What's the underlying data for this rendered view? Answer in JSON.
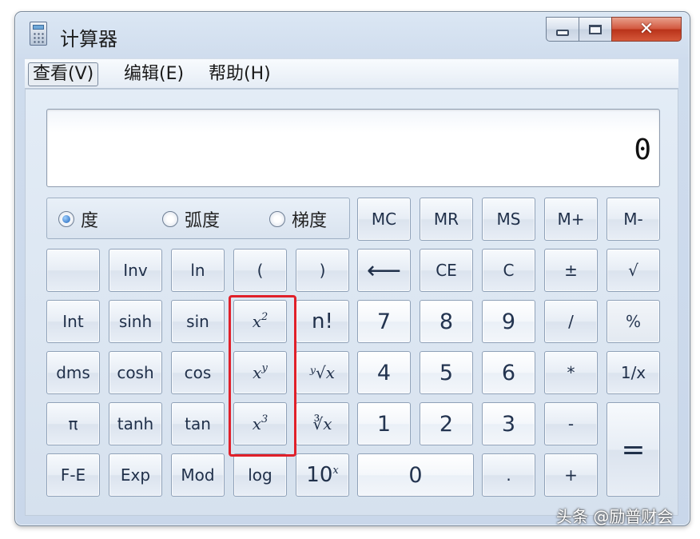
{
  "window": {
    "title": "计算器"
  },
  "menu": {
    "view": "查看(V)",
    "edit": "编辑(E)",
    "help": "帮助(H)"
  },
  "display": {
    "value": "0"
  },
  "angle_modes": {
    "degrees": "度",
    "radians": "弧度",
    "grads": "梯度",
    "selected": "度"
  },
  "memory": {
    "mc": "MC",
    "mr": "MR",
    "ms": "MS",
    "mplus": "M+",
    "mminus": "M-"
  },
  "row2": {
    "inv": "Inv",
    "ln": "ln",
    "lparen": "(",
    "rparen": ")",
    "backspace": "⟵",
    "ce": "CE",
    "c": "C",
    "plusminus": "±",
    "sqrt": "√"
  },
  "row3": {
    "int": "Int",
    "sinh": "sinh",
    "sin": "sin",
    "x": "x",
    "x2_exp": "2",
    "nfact": "n!",
    "seven": "7",
    "eight": "8",
    "nine": "9",
    "divide": "/",
    "percent": "%"
  },
  "row4": {
    "dms": "dms",
    "cosh": "cosh",
    "cos": "cos",
    "x": "x",
    "xy_exp": "y",
    "yroot": "ʸ√x",
    "four": "4",
    "five": "5",
    "six": "6",
    "multiply": "*",
    "reciprocal": "1/x"
  },
  "row5": {
    "pi": "π",
    "tanh": "tanh",
    "tan": "tan",
    "x": "x",
    "x3_exp": "3",
    "cuberoot": "∛x",
    "one": "1",
    "two": "2",
    "three": "3",
    "minus": "-",
    "equals": "="
  },
  "row6": {
    "fe": "F-E",
    "exp": "Exp",
    "mod": "Mod",
    "log": "log",
    "tenx_base": "10",
    "tenx_exp": "x",
    "zero": "0",
    "dot": ".",
    "plus": "+"
  },
  "watermark": "头条 @励普财会",
  "colors": {
    "highlight": "#e0202a",
    "accent": "#1f63b8"
  }
}
